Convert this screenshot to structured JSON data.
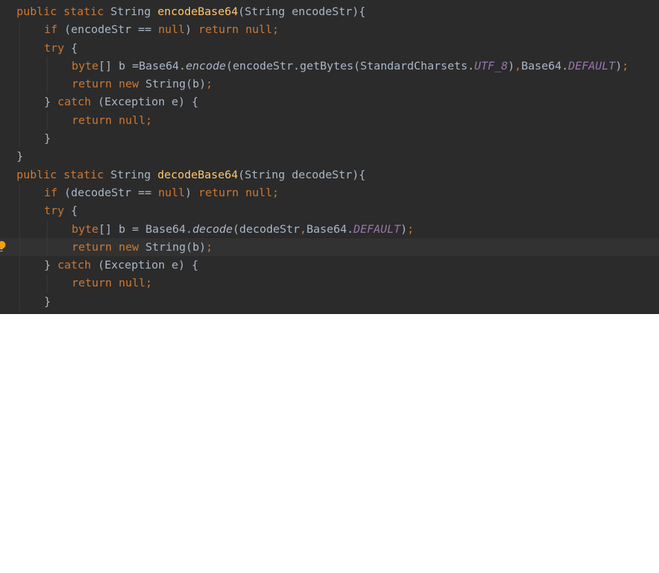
{
  "colors": {
    "background": "#2b2b2b",
    "keyword": "#cc7832",
    "identifier": "#a9b7c6",
    "method_name": "#ffc66d",
    "constant": "#9876aa",
    "current_line": "#323232",
    "bulb": "#f0a30a"
  },
  "gutter": {
    "intention_icon": "lightbulb-icon",
    "intention_line": 13
  },
  "lines": [
    {
      "indent": 0,
      "tokens": [
        {
          "t": "kw",
          "text": "public"
        },
        {
          "t": "id",
          "text": " "
        },
        {
          "t": "kw",
          "text": "static"
        },
        {
          "t": "id",
          "text": " String "
        },
        {
          "t": "fn",
          "text": "encodeBase64"
        },
        {
          "t": "id",
          "text": "(String encodeStr){"
        }
      ]
    },
    {
      "indent": 1,
      "tokens": [
        {
          "t": "kw",
          "text": "if"
        },
        {
          "t": "id",
          "text": " (encodeStr == "
        },
        {
          "t": "kw",
          "text": "null"
        },
        {
          "t": "id",
          "text": ") "
        },
        {
          "t": "kw",
          "text": "return"
        },
        {
          "t": "id",
          "text": " "
        },
        {
          "t": "kw",
          "text": "null;"
        }
      ]
    },
    {
      "indent": 1,
      "tokens": [
        {
          "t": "kw",
          "text": "try"
        },
        {
          "t": "id",
          "text": " {"
        }
      ]
    },
    {
      "indent": 2,
      "tokens": [
        {
          "t": "kw",
          "text": "byte"
        },
        {
          "t": "id",
          "text": "[] b =Base64."
        },
        {
          "t": "it",
          "text": "encode"
        },
        {
          "t": "id",
          "text": "(encodeStr.getBytes(StandardCharsets."
        },
        {
          "t": "const",
          "text": "UTF_8"
        },
        {
          "t": "id",
          "text": ")"
        },
        {
          "t": "kw",
          "text": ","
        },
        {
          "t": "id",
          "text": "Base64."
        },
        {
          "t": "const",
          "text": "DEFAULT"
        },
        {
          "t": "id",
          "text": ")"
        },
        {
          "t": "kw",
          "text": ";"
        }
      ]
    },
    {
      "indent": 2,
      "tokens": [
        {
          "t": "kw",
          "text": "return"
        },
        {
          "t": "id",
          "text": " "
        },
        {
          "t": "kw",
          "text": "new"
        },
        {
          "t": "id",
          "text": " String(b)"
        },
        {
          "t": "kw",
          "text": ";"
        }
      ]
    },
    {
      "indent": 1,
      "tokens": [
        {
          "t": "id",
          "text": "} "
        },
        {
          "t": "kw",
          "text": "catch"
        },
        {
          "t": "id",
          "text": " (Exception e) {"
        }
      ]
    },
    {
      "indent": 2,
      "tokens": [
        {
          "t": "kw",
          "text": "return"
        },
        {
          "t": "id",
          "text": " "
        },
        {
          "t": "kw",
          "text": "null;"
        }
      ]
    },
    {
      "indent": 1,
      "tokens": [
        {
          "t": "id",
          "text": "}"
        }
      ]
    },
    {
      "indent": 0,
      "tokens": [
        {
          "t": "id",
          "text": "}"
        }
      ]
    },
    {
      "indent": 0,
      "tokens": [
        {
          "t": "kw",
          "text": "public"
        },
        {
          "t": "id",
          "text": " "
        },
        {
          "t": "kw",
          "text": "static"
        },
        {
          "t": "id",
          "text": " String "
        },
        {
          "t": "fn",
          "text": "decodeBase64"
        },
        {
          "t": "id",
          "text": "(String decodeStr){"
        }
      ]
    },
    {
      "indent": 1,
      "tokens": [
        {
          "t": "kw",
          "text": "if"
        },
        {
          "t": "id",
          "text": " (decodeStr == "
        },
        {
          "t": "kw",
          "text": "null"
        },
        {
          "t": "id",
          "text": ") "
        },
        {
          "t": "kw",
          "text": "return"
        },
        {
          "t": "id",
          "text": " "
        },
        {
          "t": "kw",
          "text": "null;"
        }
      ]
    },
    {
      "indent": 1,
      "tokens": [
        {
          "t": "kw",
          "text": "try"
        },
        {
          "t": "id",
          "text": " {"
        }
      ]
    },
    {
      "indent": 2,
      "tokens": [
        {
          "t": "kw",
          "text": "byte"
        },
        {
          "t": "id",
          "text": "[] b = Base64."
        },
        {
          "t": "it",
          "text": "decode"
        },
        {
          "t": "id",
          "text": "(decodeStr"
        },
        {
          "t": "kw",
          "text": ","
        },
        {
          "t": "id",
          "text": "Base64."
        },
        {
          "t": "const",
          "text": "DEFAULT"
        },
        {
          "t": "id",
          "text": ")"
        },
        {
          "t": "kw",
          "text": ";"
        }
      ]
    },
    {
      "indent": 2,
      "current": true,
      "tokens": [
        {
          "t": "kw",
          "text": "return"
        },
        {
          "t": "id",
          "text": " "
        },
        {
          "t": "kw",
          "text": "new"
        },
        {
          "t": "id",
          "text": " String(b)"
        },
        {
          "t": "kw",
          "text": ";"
        }
      ]
    },
    {
      "indent": 1,
      "tokens": [
        {
          "t": "id",
          "text": "} "
        },
        {
          "t": "kw",
          "text": "catch"
        },
        {
          "t": "id",
          "text": " (Exception e) {"
        }
      ]
    },
    {
      "indent": 2,
      "tokens": [
        {
          "t": "kw",
          "text": "return"
        },
        {
          "t": "id",
          "text": " "
        },
        {
          "t": "kw",
          "text": "null;"
        }
      ]
    },
    {
      "indent": 1,
      "tokens": [
        {
          "t": "id",
          "text": "}"
        }
      ]
    }
  ]
}
